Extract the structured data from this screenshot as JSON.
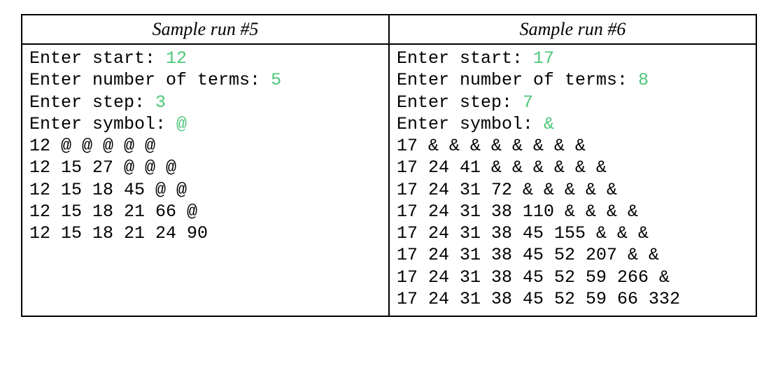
{
  "left": {
    "title": "Sample run #5",
    "prompts": [
      {
        "label": "Enter start: ",
        "value": "12"
      },
      {
        "label": "Enter number of terms: ",
        "value": "5"
      },
      {
        "label": "Enter step: ",
        "value": "3"
      },
      {
        "label": "Enter symbol: ",
        "value": "@"
      }
    ],
    "output": [
      "12 @ @ @ @ @",
      "12 15 27 @ @ @",
      "12 15 18 45 @ @",
      "12 15 18 21 66 @",
      "12 15 18 21 24 90"
    ]
  },
  "right": {
    "title": "Sample run #6",
    "prompts": [
      {
        "label": "Enter start: ",
        "value": "17"
      },
      {
        "label": "Enter number of terms: ",
        "value": "8"
      },
      {
        "label": "Enter step: ",
        "value": "7"
      },
      {
        "label": "Enter symbol: ",
        "value": "&"
      }
    ],
    "output": [
      "17 & & & & & & & &",
      "17 24 41 & & & & & &",
      "17 24 31 72 & & & & &",
      "17 24 31 38 110 & & & &",
      "17 24 31 38 45 155 & & &",
      "17 24 31 38 45 52 207 & &",
      "17 24 31 38 45 52 59 266 &",
      "17 24 31 38 45 52 59 66 332"
    ]
  }
}
